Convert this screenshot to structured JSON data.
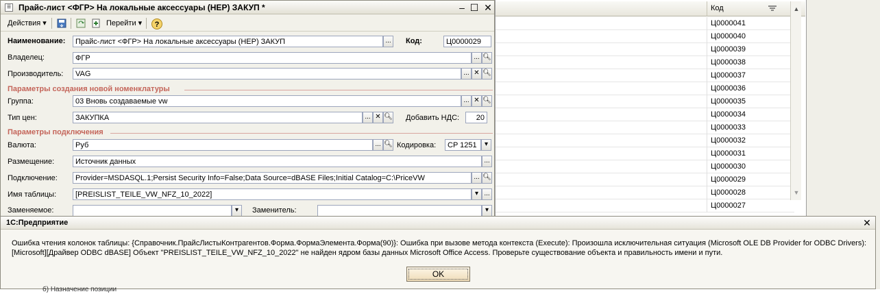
{
  "form": {
    "title": "Прайс-лист <ФГР> На локальные аксессуары (НЕР) ЗАКУП *",
    "window_buttons": {
      "minimize": "–",
      "maximize": "☐",
      "close": "✕"
    },
    "toolbar": {
      "actions_label": "Действия",
      "goto_label": "Перейти",
      "help_label": "?"
    },
    "name_label": "Наименование:",
    "name_value": "Прайс-лист <ФГР> На локальные аксессуары (НЕР) ЗАКУП",
    "code_label": "Код:",
    "code_value": "Ц0000029",
    "owner_label": "Владелец:",
    "owner_value": "ФГР",
    "manufacturer_label": "Производитель:",
    "manufacturer_value": "VAG",
    "section_new_nomenclature": "Параметры создания новой номенклатуры",
    "group_label": "Группа:",
    "group_value": "03 Вновь создаваемые vw",
    "price_type_label": "Тип цен:",
    "price_type_value": "ЗАКУПКА",
    "add_vat_label": "Добавить НДС:",
    "add_vat_value": "20",
    "section_connection": "Параметры подключения",
    "currency_label": "Валюта:",
    "currency_value": "Руб",
    "encoding_label": "Кодировка:",
    "encoding_value": "CP 1251",
    "location_label": "Размещение:",
    "location_value": "Источник данных",
    "connection_label": "Подключение:",
    "connection_value": "Provider=MSDASQL.1;Persist Security Info=False;Data Source=dBASE Files;Initial Catalog=C:\\PriceVW",
    "table_name_label": "Имя таблицы:",
    "table_name_value": "[PREISLIST_TEILE_VW_NFZ_10_2022]",
    "replaceable_label": "Заменяемое:",
    "replacement_label": "Заменитель:"
  },
  "list": {
    "column_header": "Код",
    "rows": [
      "Ц0000041",
      "Ц0000040",
      "Ц0000039",
      "Ц0000038",
      "Ц0000037",
      "Ц0000036",
      "Ц0000035",
      "Ц0000034",
      "Ц0000033",
      "Ц0000032",
      "Ц0000031",
      "Ц0000030",
      "Ц0000029",
      "Ц0000028",
      "Ц0000027"
    ]
  },
  "dialog": {
    "title": "1С:Предприятие",
    "message_line1": "Ошибка чтения колонок таблицы: {Справочник.ПрайсЛистыКонтрагентов.Форма.ФормаЭлемента.Форма(90)}: Ошибка при вызове метода контекста (Execute): Произошла исключительная ситуация (Microsoft OLE DB Provider for ODBC Drivers):",
    "message_line2": "[Microsoft][Драйвер ODBC dBASE] Объект \"PREISLIST_TEILE_VW_NFZ_10_2022\" не найден ядром базы данных Microsoft Office Access.  Проверьте существование объекта и правильность имени и пути.",
    "ok_label": "OK",
    "close_glyph": "✕"
  },
  "bottom_text": "б) Назначение позиции"
}
